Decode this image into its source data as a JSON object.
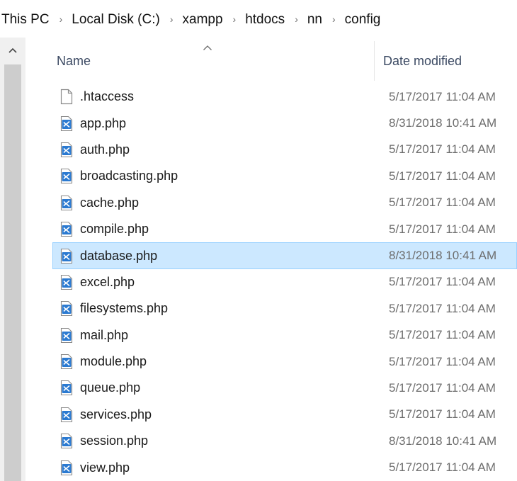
{
  "breadcrumb": [
    "This PC",
    "Local Disk (C:)",
    "xampp",
    "htdocs",
    "nn",
    "config"
  ],
  "breadcrumb_separator_icon": "chevron-right-icon",
  "columns": {
    "name": "Name",
    "date_modified": "Date modified"
  },
  "sort_indicator_icon": "sort-ascending-caret-icon",
  "scroll_up_icon": "scroll-up-caret-icon",
  "files": [
    {
      "name": ".htaccess",
      "date": "5/17/2017 11:04 AM",
      "icon": "blank-file-icon",
      "selected": false
    },
    {
      "name": "app.php",
      "date": "8/31/2018 10:41 AM",
      "icon": "vscode-file-icon",
      "selected": false
    },
    {
      "name": "auth.php",
      "date": "5/17/2017 11:04 AM",
      "icon": "vscode-file-icon",
      "selected": false
    },
    {
      "name": "broadcasting.php",
      "date": "5/17/2017 11:04 AM",
      "icon": "vscode-file-icon",
      "selected": false
    },
    {
      "name": "cache.php",
      "date": "5/17/2017 11:04 AM",
      "icon": "vscode-file-icon",
      "selected": false
    },
    {
      "name": "compile.php",
      "date": "5/17/2017 11:04 AM",
      "icon": "vscode-file-icon",
      "selected": false
    },
    {
      "name": "database.php",
      "date": "8/31/2018 10:41 AM",
      "icon": "vscode-file-icon",
      "selected": true
    },
    {
      "name": "excel.php",
      "date": "5/17/2017 11:04 AM",
      "icon": "vscode-file-icon",
      "selected": false
    },
    {
      "name": "filesystems.php",
      "date": "5/17/2017 11:04 AM",
      "icon": "vscode-file-icon",
      "selected": false
    },
    {
      "name": "mail.php",
      "date": "5/17/2017 11:04 AM",
      "icon": "vscode-file-icon",
      "selected": false
    },
    {
      "name": "module.php",
      "date": "5/17/2017 11:04 AM",
      "icon": "vscode-file-icon",
      "selected": false
    },
    {
      "name": "queue.php",
      "date": "5/17/2017 11:04 AM",
      "icon": "vscode-file-icon",
      "selected": false
    },
    {
      "name": "services.php",
      "date": "5/17/2017 11:04 AM",
      "icon": "vscode-file-icon",
      "selected": false
    },
    {
      "name": "session.php",
      "date": "8/31/2018 10:41 AM",
      "icon": "vscode-file-icon",
      "selected": false
    },
    {
      "name": "view.php",
      "date": "5/17/2017 11:04 AM",
      "icon": "vscode-file-icon",
      "selected": false
    }
  ],
  "colors": {
    "selection_fill": "#cce8ff",
    "selection_border": "#99d1ff",
    "vscode_blue": "#2b7ad1",
    "date_text": "#6d6d6d"
  }
}
